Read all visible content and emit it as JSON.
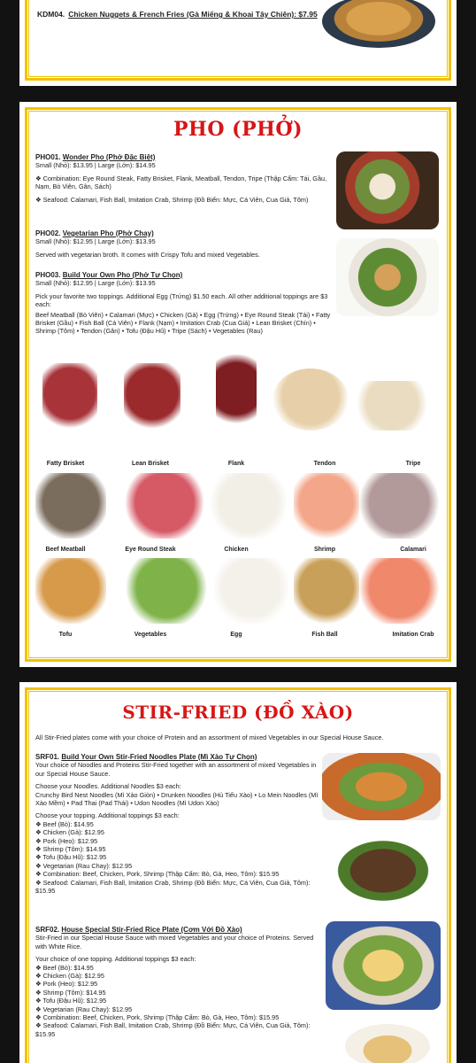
{
  "page1": {
    "item": {
      "code": "KDM04.",
      "name": "Chicken Nuggets & French Fries (Gà Miếng & Khoai Tây Chiên): $7.95"
    }
  },
  "pho": {
    "title": "PHO (PHỞ)",
    "items": [
      {
        "code": "PHO01.",
        "name": "Wonder Pho (Phở Đặc Biệt)",
        "sizes": "Small (Nhỏ): $13.95 | Large (Lớn): $14.95",
        "lines": [
          "❖ Combination: Eye Round Steak, Fatty Brisket, Flank, Meatball, Tendon, Tripe (Thập Cẩm: Tái, Gầu, Nạm, Bò Viên, Gân, Sách)",
          "❖ Seafood: Calamari, Fish Ball, Imitation Crab, Shrimp (Đồ Biển: Mực, Cá Viên, Cua Giả, Tôm)"
        ]
      },
      {
        "code": "PHO02.",
        "name": "Vegetarian Pho (Phở Chay)",
        "sizes": "Small (Nhỏ): $12.95 | Large (Lớn): $13.95",
        "lines": [
          "Served with vegetarian broth. It comes with Crispy Tofu and mixed Vegetables."
        ]
      },
      {
        "code": "PHO03.",
        "name": "Build Your Own Pho (Phở Tự Chọn)",
        "sizes": "Small (Nhỏ): $12.95 | Large (Lớn): $13.95",
        "lines": [
          "Pick your favorite two toppings. Additional Egg (Trứng) $1.50 each. All other additional toppings are $3 each:",
          "Beef Meatball (Bò Viên) • Calamari (Mực) • Chicken (Gà) • Egg (Trứng) • Eye Round Steak (Tái) • Fatty Brisket (Gầu) • Fish Ball (Cá Viên) • Flank (Nạm) • Imitation Crab (Cua Giả) • Lean Brisket (Chín) • Shrimp (Tôm) • Tendon (Gân) • Tofu (Đậu Hũ) • Tripe (Sách) • Vegetables (Rau)"
        ]
      }
    ],
    "ingredients": [
      {
        "label": "Fatty Brisket",
        "color": "#a8343a"
      },
      {
        "label": "Lean Brisket",
        "color": "#9b2a2d"
      },
      {
        "label": "Flank",
        "color": "#7e1d22"
      },
      {
        "label": "Tendon",
        "color": "#e7cfa9"
      },
      {
        "label": "Tripe",
        "color": "#e9dcc0"
      },
      {
        "label": "Beef Meatball",
        "color": "#7b6d5e"
      },
      {
        "label": "Eye Round Steak",
        "color": "#d65a66"
      },
      {
        "label": "Chicken",
        "color": "#f1efe6"
      },
      {
        "label": "Shrimp",
        "color": "#f3a68a"
      },
      {
        "label": "Calamari",
        "color": "#b39a9a"
      },
      {
        "label": "Tofu",
        "color": "#d79a4b"
      },
      {
        "label": "Vegetables",
        "color": "#7fb34a"
      },
      {
        "label": "Egg",
        "color": "#f4f1ea"
      },
      {
        "label": "Fish Ball",
        "color": "#c9a05a"
      },
      {
        "label": "Imitation Crab",
        "color": "#f0886c"
      }
    ]
  },
  "stir": {
    "title": "STIR-FRIED (ĐỒ XÀO)",
    "intro": "All Stir-Fried plates come with your choice of Protein and an assortment of mixed Vegetables in our Special House Sauce.",
    "items": [
      {
        "code": "SRF01.",
        "name": "Build Your Own Stir-Fried Noodles Plate (Mì Xào Tự Chọn)",
        "lines": [
          "Your choice of Noodles and Proteins Stir-Fried together with an assortment of mixed Vegetables in our Special House Sauce.",
          "Choose your Noodles. Additional Noodles $3 each:",
          "Crunchy Bird Nest Noodles (Mì Xào Giòn) • Drunken Noodles (Hủ Tiếu Xào) • Lo Mein Noodles (Mì Xào Mềm) • Pad Thai (Pad Thái) • Udon Noodles (Mì Udon Xào)",
          "Choose your topping. Additional toppings $3 each:",
          "❖ Beef (Bò): $14.95",
          "❖ Chicken (Gà): $12.95",
          "❖ Pork (Heo): $12.95",
          "❖ Shrimp (Tôm): $14.95",
          "❖ Tofu (Đậu Hũ): $12.95",
          "❖ Vegetarian (Rau Chay): $12.95",
          "❖ Combination: Beef, Chicken, Pork, Shrimp (Thập Cẩm: Bò, Gà, Heo, Tôm): $15.95",
          "❖ Seafood: Calamari, Fish Ball, Imitation Crab, Shrimp (Đồ Biển: Mực, Cá Viên, Cua Giả, Tôm): $15.95"
        ]
      },
      {
        "code": "SRF02.",
        "name": "House Special Stir-Fried Rice Plate (Cơm Với Đồ Xào)",
        "lines": [
          "Stir-Fried in our Special House Sauce with mixed Vegetables and your choice of Proteins. Served with White Rice.",
          "Your choice of one topping. Additional toppings $3 each:",
          "❖ Beef (Bò): $14.95",
          "❖ Chicken (Gà): $12.95",
          "❖ Pork (Heo): $12.95",
          "❖ Shrimp (Tôm): $14.95",
          "❖ Tofu (Đậu Hũ): $12.95",
          "❖ Vegetarian (Rau Chay): $12.95",
          "❖ Combination: Beef, Chicken, Pork, Shrimp (Thập Cẩm: Bò, Gà, Heo, Tôm): $15.95",
          "❖ Seafood: Calamari, Fish Ball, Imitation Crab, Shrimp (Đồ Biển: Mực, Cá Viên, Cua Giả, Tôm): $15.95"
        ]
      }
    ]
  },
  "colors": {
    "accent_red": "#d71616",
    "frame_yellow": "#f2c200",
    "background": "#121212"
  }
}
